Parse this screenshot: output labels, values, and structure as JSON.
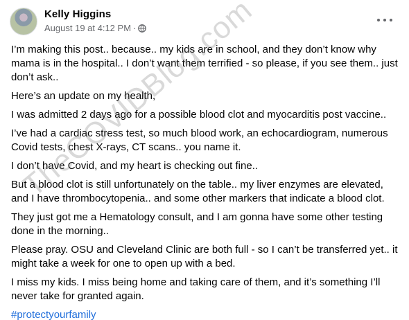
{
  "post": {
    "author": "Kelly Higgins",
    "date": "August 19 at 4:12 PM",
    "separator": "·",
    "privacy_icon": "globe-icon",
    "more_icon": "more-options-icon",
    "paragraphs": [
      "I’m making this post.. because.. my kids are in school, and they don’t know why mama is in the hospital.. I don’t want them terrified - so please, if you see them.. just don’t ask..",
      "Here’s an update on my health,",
      "I was admitted 2 days ago for a possible blood clot and myocarditis post vaccine..",
      "I’ve had a cardiac stress test, so much blood work, an echocardiogram, numerous Covid tests, chest X-rays, CT scans.. you name it.",
      "I don’t have Covid, and my heart is checking out fine..",
      "But a blood clot is still unfortunately on the table.. my liver enzymes are elevated, and I have thrombocytopenia.. and some other markers that indicate a blood clot.",
      "They just got me a Hematology consult, and I am gonna have some other testing done in the morning..",
      "Please pray. OSU and Cleveland Clinic are both full - so I can’t be transferred yet.. it might take a week for one to open up with a bed.",
      "I miss my kids. I miss being home and taking care of them, and it’s something I’ll never take for granted again."
    ],
    "hashtag": "#protectyourfamily"
  },
  "watermark": "TheCOVIDBlog.com",
  "colors": {
    "text": "#050505",
    "meta": "#65676b",
    "link": "#216fdb"
  }
}
